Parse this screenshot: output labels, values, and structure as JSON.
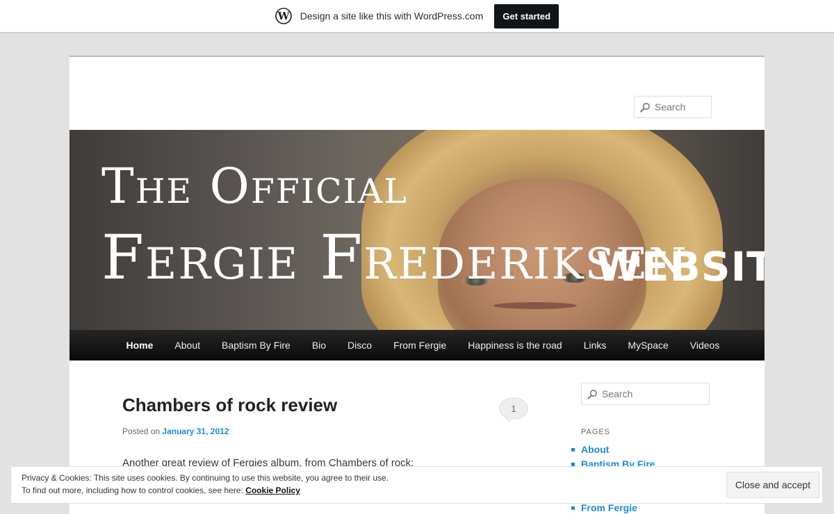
{
  "wp_bar": {
    "logo_icon": "wordpress-logo-icon",
    "text": "Design a site like this with WordPress.com",
    "cta_label": "Get started"
  },
  "header": {
    "search_placeholder": "Search",
    "banner_lines": [
      "The Official",
      "Fergie Frederiksen",
      "WEBSITE"
    ]
  },
  "nav": {
    "items": [
      "Home",
      "About",
      "Baptism By Fire",
      "Bio",
      "Disco",
      "From Fergie",
      "Happiness is the road",
      "Links",
      "MySpace",
      "Videos"
    ],
    "current": "Home"
  },
  "post": {
    "title": "Chambers of rock review",
    "comment_count": "1",
    "posted_prefix": "Posted on",
    "date": "January 31, 2012",
    "excerpt": "Another great review of Fergies album, from Chambers of rock:"
  },
  "sidebar": {
    "search_placeholder": "Search",
    "widget_title": "PAGES",
    "pages": [
      "About",
      "Baptism By Fire",
      "From Fergie"
    ]
  },
  "cookie": {
    "line1": "Privacy & Cookies: This site uses cookies. By continuing to use this website, you agree to their use.",
    "line2_prefix": "To find out more, including how to control cookies, see here:",
    "link": "Cookie Policy",
    "accept_label": "Close and accept"
  },
  "colors": {
    "link": "#1b8be0",
    "page_bg": "#e2e2e2",
    "nav_bg": "#0a0a0a",
    "cta_bg": "#101517"
  }
}
